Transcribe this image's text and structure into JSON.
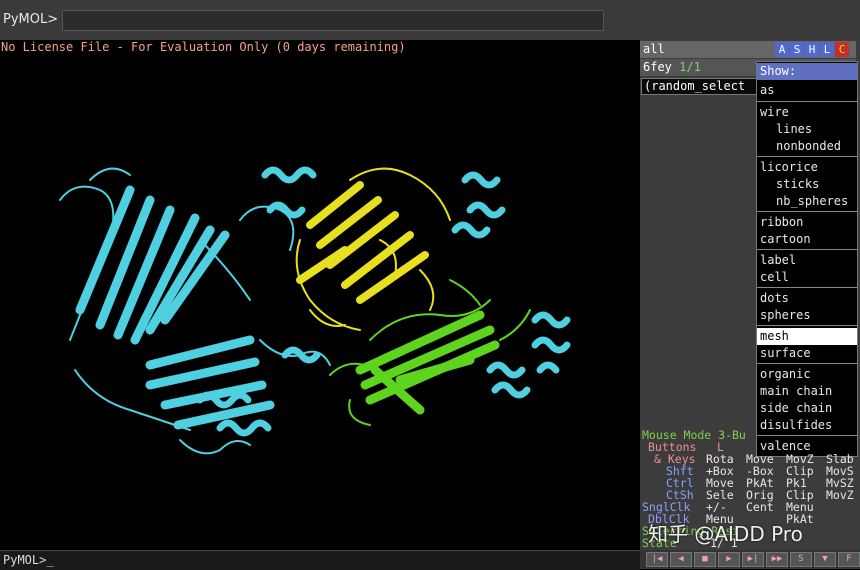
{
  "top": {
    "prompt": "PyMOL>",
    "input_value": ""
  },
  "viewer": {
    "license_text": "No License File - For Evaluation Only (0 days remaining)"
  },
  "bottom": {
    "command_line": "PyMOL>_"
  },
  "objects": [
    {
      "name": "all",
      "buttons": [
        "A",
        "S",
        "H",
        "L",
        "C"
      ]
    },
    {
      "name": "6fey",
      "count": "1/1"
    },
    {
      "name": "(random_select"
    }
  ],
  "show_menu": {
    "title": "Show:",
    "items": [
      "as",
      "wire",
      "lines",
      "nonbonded",
      "licorice",
      "sticks",
      "nb_spheres",
      "ribbon",
      "cartoon",
      "label",
      "cell",
      "dots",
      "spheres",
      "mesh",
      "surface",
      "organic",
      "main chain",
      "side chain",
      "disulfides",
      "valence"
    ],
    "highlighted": "mesh"
  },
  "mouse_mode": {
    "title": "Mouse Mode 3-Bu",
    "buttons_label": "Buttons",
    "buttons_l": "L",
    "rows": [
      {
        "key": "& Keys",
        "c1": "Rota",
        "c2": "Move",
        "c3": "MovZ",
        "c4": "Slab"
      },
      {
        "key": "Shft",
        "c1": "+Box",
        "c2": "-Box",
        "c3": "Clip",
        "c4": "MovS"
      },
      {
        "key": "Ctrl",
        "c1": "Move",
        "c2": "PkAt",
        "c3": "Pk1",
        "c4": "MvSZ"
      },
      {
        "key": "CtSh",
        "c1": "Sele",
        "c2": "Orig",
        "c3": "Clip",
        "c4": "MovZ"
      },
      {
        "key": "SnglClk",
        "c1": "+/-",
        "c2": "Cent",
        "c3": "Menu",
        "c4": ""
      },
      {
        "key": "DblClk",
        "c1": "Menu",
        "c2": "",
        "c3": "PkAt",
        "c4": ""
      }
    ],
    "selecting": "Selecting Resi",
    "state": "State",
    "state_val": "1/ 1"
  },
  "controls": {
    "buttons": [
      "|◀",
      "◀",
      "■",
      "▶",
      "▶|",
      "▶▶",
      "S",
      "▼",
      "F"
    ]
  },
  "watermark": "知乎 @AIDD Pro",
  "colors": {
    "chain_a": "#4fd0e0",
    "chain_b": "#e6e01e",
    "chain_c": "#5fd41e",
    "license": "#f7a08c",
    "menu_title": "#6070c0"
  }
}
